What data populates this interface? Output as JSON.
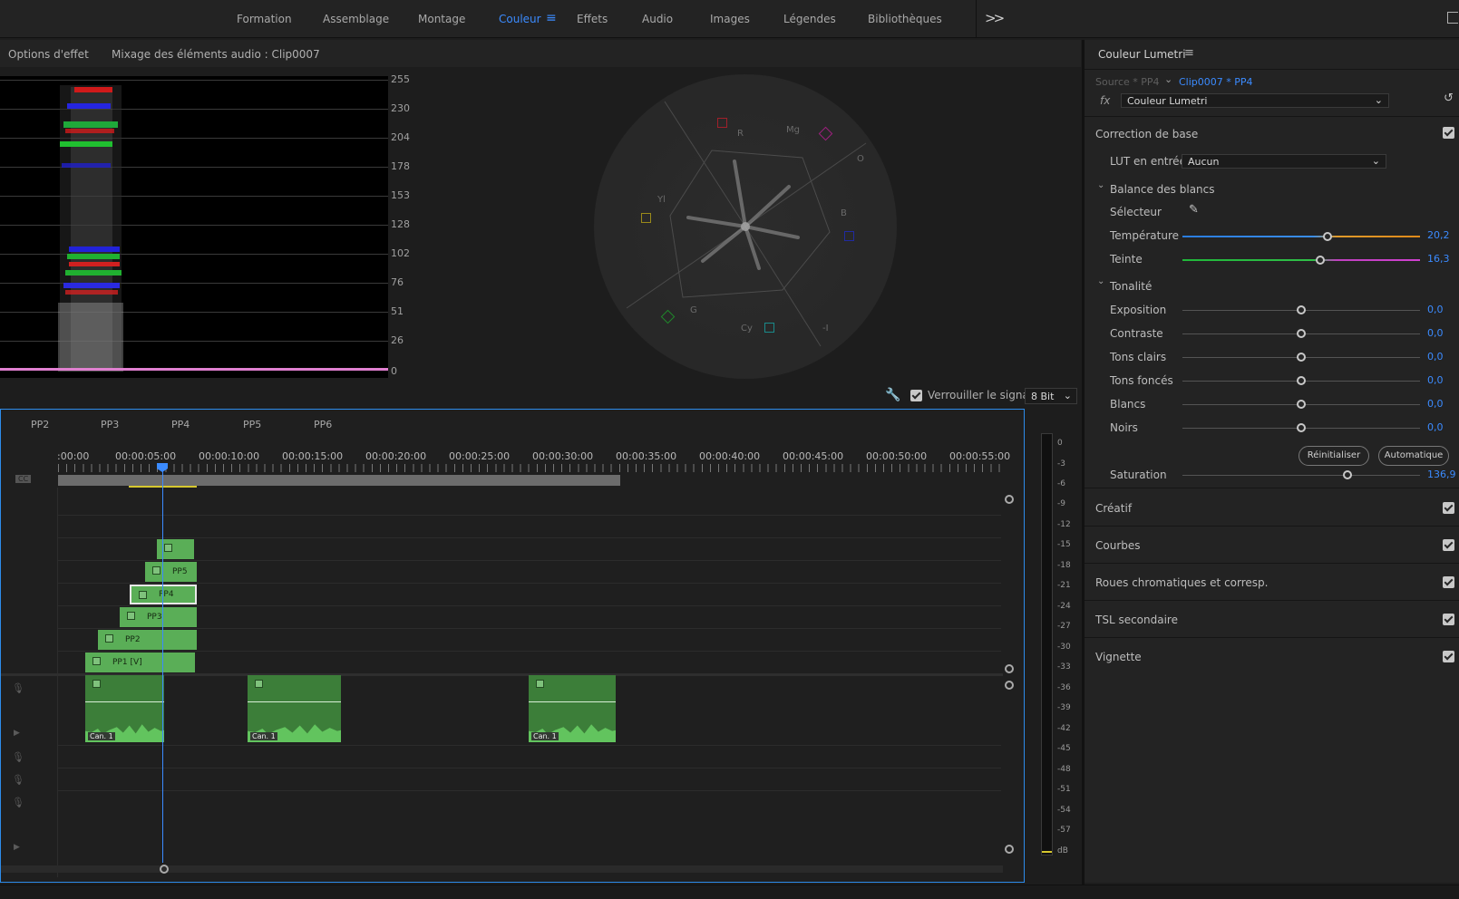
{
  "workspaces": {
    "items": [
      "Formation",
      "Assemblage",
      "Montage",
      "Couleur",
      "Effets",
      "Audio",
      "Images",
      "Légendes",
      "Bibliothèques"
    ],
    "active": "Couleur",
    "more_label": ">>"
  },
  "panels": {
    "effect_options": "Options d'effet",
    "audio_mixer": "Mixage des éléments audio : Clip0007"
  },
  "waveform": {
    "scale": [
      "255",
      "230",
      "204",
      "178",
      "153",
      "128",
      "102",
      "76",
      "51",
      "26",
      "0"
    ]
  },
  "vectorscope": {
    "labels": {
      "r": "R",
      "mg": "Mg",
      "o": "O",
      "b": "B",
      "yl": "Yl",
      "g": "G",
      "cy": "Cy",
      "i": "-I"
    },
    "colors": {
      "r": "#a0202a",
      "mg": "#a02080",
      "b": "#202aa0",
      "yl": "#9a8a1a",
      "g": "#1f8a2a",
      "cy": "#1a8a8a"
    }
  },
  "scope_controls": {
    "lock_signal_label": "Verrouiller le signal",
    "lock_signal_checked": true,
    "bit_depth": "8 Bit"
  },
  "timeline": {
    "markers": [
      "PP2",
      "PP3",
      "PP4",
      "PP5",
      "PP6"
    ],
    "timecodes": [
      ":00:00",
      "00:00:05:00",
      "00:00:10:00",
      "00:00:15:00",
      "00:00:20:00",
      "00:00:25:00",
      "00:00:30:00",
      "00:00:35:00",
      "00:00:40:00",
      "00:00:45:00",
      "00:00:50:00",
      "00:00:55:00"
    ],
    "video_clips": [
      "",
      "PP5",
      "PP4",
      "PP3",
      "PP2",
      "PP1 [V]"
    ],
    "audio_clips": [
      "Can. 1",
      "Can. 1",
      "Can. 1"
    ],
    "cc_label": "CC"
  },
  "meter": {
    "scale": [
      "0",
      "-3",
      "-6",
      "-9",
      "-12",
      "-15",
      "-18",
      "-21",
      "-24",
      "-27",
      "-30",
      "-33",
      "-36",
      "-39",
      "-42",
      "-45",
      "-48",
      "-51",
      "-54",
      "-57",
      "dB"
    ]
  },
  "lumetri": {
    "title": "Couleur Lumetri",
    "source": "Source * PP4",
    "clip": "Clip0007 * PP4",
    "fx_label": "fx",
    "effect": "Couleur Lumetri",
    "basic": {
      "title": "Correction de base",
      "lut_label": "LUT en entrée",
      "lut_value": "Aucun",
      "wb_title": "Balance des blancs",
      "picker_label": "Sélecteur",
      "temperature_label": "Température",
      "temperature_value": "20,2",
      "tint_label": "Teinte",
      "tint_value": "16,3",
      "tone_title": "Tonalité",
      "tone": [
        {
          "label": "Exposition",
          "value": "0,0"
        },
        {
          "label": "Contraste",
          "value": "0,0"
        },
        {
          "label": "Tons clairs",
          "value": "0,0"
        },
        {
          "label": "Tons foncés",
          "value": "0,0"
        },
        {
          "label": "Blancs",
          "value": "0,0"
        },
        {
          "label": "Noirs",
          "value": "0,0"
        }
      ],
      "reset_label": "Réinitialiser",
      "auto_label": "Automatique",
      "saturation_label": "Saturation",
      "saturation_value": "136,9"
    },
    "sections": [
      "Créatif",
      "Courbes",
      "Roues chromatiques et corresp.",
      "TSL secondaire",
      "Vignette"
    ]
  }
}
